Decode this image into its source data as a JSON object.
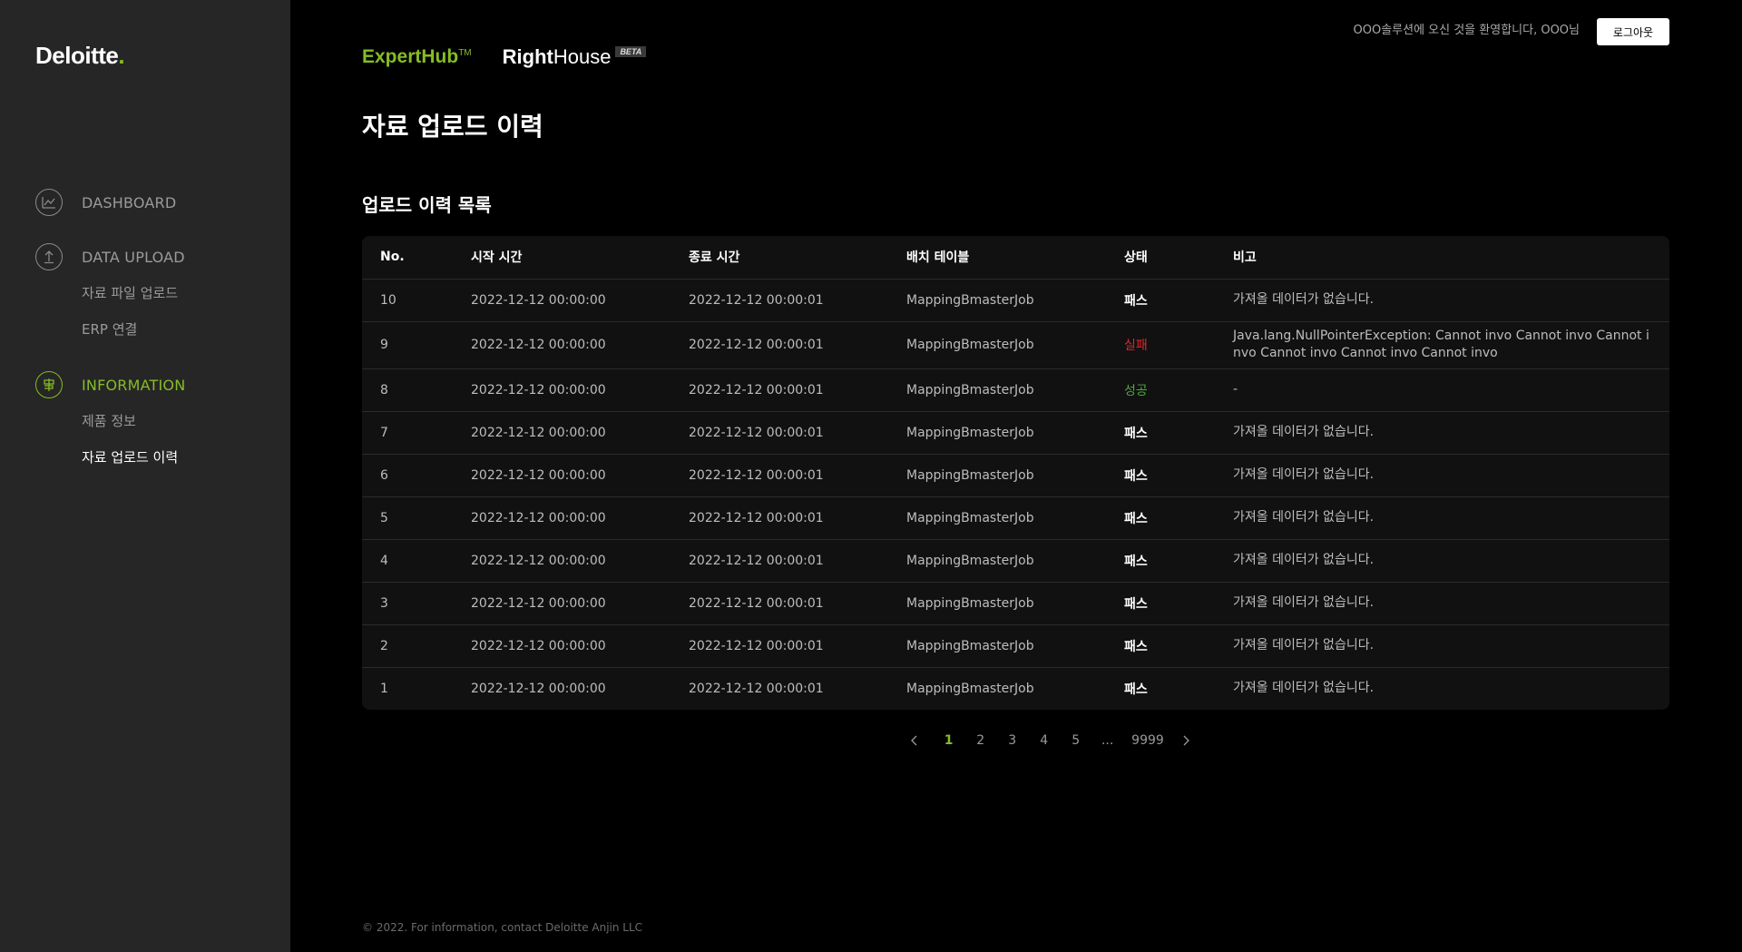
{
  "brand": {
    "logo": "Deloitte",
    "logo_dot": ".",
    "expert": "ExpertHub",
    "expert_tm": "TM",
    "right_bold": "Right",
    "right_rest": "House",
    "beta": "BETA"
  },
  "header": {
    "welcome": "OOO솔루션에 오신 것을 환영합니다, OOO님",
    "logout": "로그아웃"
  },
  "sidebar": {
    "dashboard": "DASHBOARD",
    "data_upload": "DATA UPLOAD",
    "data_upload_items": [
      "자료 파일 업로드",
      "ERP 연결"
    ],
    "information": "INFORMATION",
    "information_items": [
      "제품 정보",
      "자료 업로드 이력"
    ]
  },
  "page": {
    "title": "자료 업로드 이력",
    "section_title": "업로드 이력 목록"
  },
  "table": {
    "columns": [
      "No.",
      "시작 시간",
      "종료 시간",
      "배치 테이블",
      "상태",
      "비고"
    ],
    "rows": [
      {
        "no": "10",
        "start": "2022-12-12 00:00:00",
        "end": "2022-12-12 00:00:01",
        "batch": "MappingBmasterJob",
        "status": "패스",
        "status_type": "pass",
        "note": "가져올 데이터가 없습니다."
      },
      {
        "no": "9",
        "start": "2022-12-12 00:00:00",
        "end": "2022-12-12 00:00:01",
        "batch": "MappingBmasterJob",
        "status": "실패",
        "status_type": "fail",
        "note": "Java.lang.NullPointerException: Cannot invo Cannot invo Cannot invo Cannot invo Cannot invo Cannot invo"
      },
      {
        "no": "8",
        "start": "2022-12-12 00:00:00",
        "end": "2022-12-12 00:00:01",
        "batch": "MappingBmasterJob",
        "status": "성공",
        "status_type": "ok",
        "note": "-"
      },
      {
        "no": "7",
        "start": "2022-12-12 00:00:00",
        "end": "2022-12-12 00:00:01",
        "batch": "MappingBmasterJob",
        "status": "패스",
        "status_type": "pass",
        "note": "가져올 데이터가 없습니다."
      },
      {
        "no": "6",
        "start": "2022-12-12 00:00:00",
        "end": "2022-12-12 00:00:01",
        "batch": "MappingBmasterJob",
        "status": "패스",
        "status_type": "pass",
        "note": "가져올 데이터가 없습니다."
      },
      {
        "no": "5",
        "start": "2022-12-12 00:00:00",
        "end": "2022-12-12 00:00:01",
        "batch": "MappingBmasterJob",
        "status": "패스",
        "status_type": "pass",
        "note": "가져올 데이터가 없습니다."
      },
      {
        "no": "4",
        "start": "2022-12-12 00:00:00",
        "end": "2022-12-12 00:00:01",
        "batch": "MappingBmasterJob",
        "status": "패스",
        "status_type": "pass",
        "note": "가져올 데이터가 없습니다."
      },
      {
        "no": "3",
        "start": "2022-12-12 00:00:00",
        "end": "2022-12-12 00:00:01",
        "batch": "MappingBmasterJob",
        "status": "패스",
        "status_type": "pass",
        "note": "가져올 데이터가 없습니다."
      },
      {
        "no": "2",
        "start": "2022-12-12 00:00:00",
        "end": "2022-12-12 00:00:01",
        "batch": "MappingBmasterJob",
        "status": "패스",
        "status_type": "pass",
        "note": "가져올 데이터가 없습니다."
      },
      {
        "no": "1",
        "start": "2022-12-12 00:00:00",
        "end": "2022-12-12 00:00:01",
        "batch": "MappingBmasterJob",
        "status": "패스",
        "status_type": "pass",
        "note": "가져올 데이터가 없습니다."
      }
    ]
  },
  "pagination": {
    "pages": [
      "1",
      "2",
      "3",
      "4",
      "5",
      "...",
      "9999"
    ],
    "current": "1"
  },
  "footer": "© 2022. For information, contact Deloitte Anjin LLC",
  "colors": {
    "accent": "#86bc25",
    "fail": "#e0252b",
    "success": "#4caa3c",
    "sidebar_bg": "#262626",
    "page_bg": "#000000"
  },
  "icons": {
    "dashboard": "line-chart-icon",
    "data_upload": "upload-arrow-icon",
    "information": "signpost-icon",
    "prev": "chevron-left-icon",
    "next": "chevron-right-icon"
  }
}
